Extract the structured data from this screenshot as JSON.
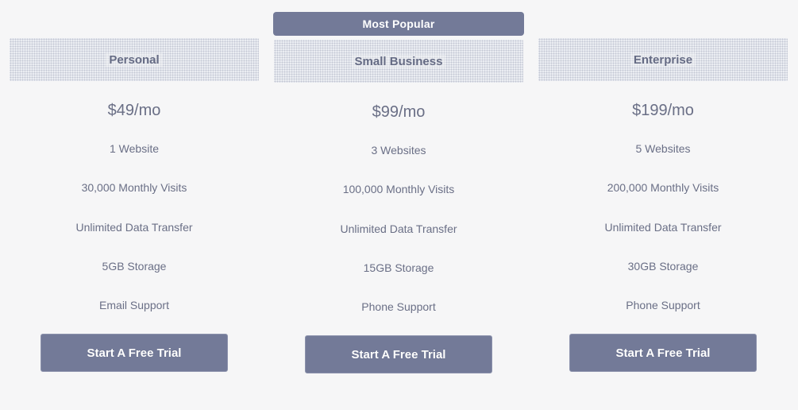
{
  "badge": {
    "label": "Most Popular"
  },
  "colors": {
    "accent": "#737a98",
    "text": "#6a6f86",
    "background": "#f6f6f7"
  },
  "plans": [
    {
      "name": "Personal",
      "price": "$49/mo",
      "features": [
        "1 Website",
        "30,000 Monthly Visits",
        "Unlimited Data Transfer",
        "5GB Storage",
        "Email Support"
      ],
      "cta": "Start A Free Trial"
    },
    {
      "name": "Small Business",
      "price": "$99/mo",
      "features": [
        "3 Websites",
        "100,000 Monthly Visits",
        "Unlimited Data Transfer",
        "15GB Storage",
        "Phone Support"
      ],
      "cta": "Start A Free Trial"
    },
    {
      "name": "Enterprise",
      "price": "$199/mo",
      "features": [
        "5 Websites",
        "200,000 Monthly Visits",
        "Unlimited Data Transfer",
        "30GB Storage",
        "Phone Support"
      ],
      "cta": "Start A Free Trial"
    }
  ]
}
